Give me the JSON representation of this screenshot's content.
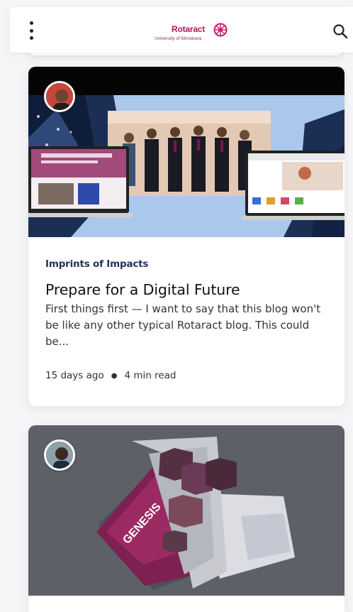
{
  "header": {
    "logo_name": "Rotaract",
    "logo_sub": "University of Moratuwa"
  },
  "posts": [
    {
      "category": "Imprints of Impacts",
      "title": "Prepare for a Digital Future",
      "excerpt": "First things first — I want to say that this blog won't be like any other typical Rotaract blog. This could be...",
      "date": "15 days ago",
      "read_time": "4 min read"
    },
    {
      "cover_text": "GENESIS"
    }
  ],
  "colors": {
    "brand": "#b0185a",
    "category": "#24315c",
    "card_bg": "#ffffff",
    "page_bg": "#f5f5f7"
  },
  "icons": {
    "menu": "more-vert-icon",
    "search": "search-icon",
    "logo": "rotary-wheel-icon"
  }
}
